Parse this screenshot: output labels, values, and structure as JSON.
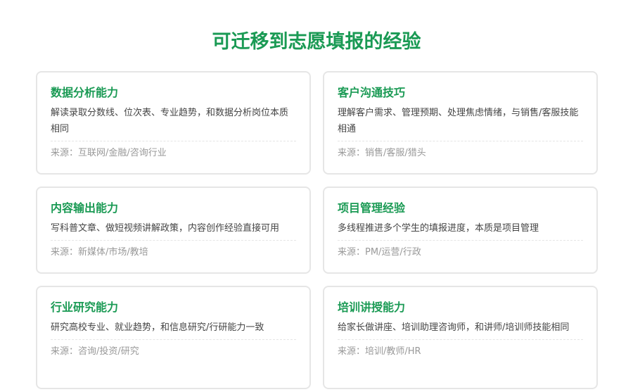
{
  "page": {
    "title": "可迁移到志愿填报的经验"
  },
  "cards": [
    {
      "title": "数据分析能力",
      "desc": "解读录取分数线、位次表、专业趋势，和数据分析岗位本质相同",
      "source": "来源：互联网/金融/咨询行业"
    },
    {
      "title": "客户沟通技巧",
      "desc": "理解客户需求、管理预期、处理焦虑情绪，与销售/客服技能相通",
      "source": "来源：销售/客服/猎头"
    },
    {
      "title": "内容输出能力",
      "desc": "写科普文章、做短视频讲解政策，内容创作经验直接可用",
      "source": "来源：新媒体/市场/教培"
    },
    {
      "title": "项目管理经验",
      "desc": "多线程推进多个学生的填报进度，本质是项目管理",
      "source": "来源：PM/运营/行政"
    },
    {
      "title": "行业研究能力",
      "desc": "研究高校专业、就业趋势，和信息研究/行研能力一致",
      "source": "来源：咨询/投资/研究"
    },
    {
      "title": "培训讲授能力",
      "desc": "给家长做讲座、培训助理咨询师，和讲师/培训师技能相同",
      "source": "来源：培训/教师/HR"
    }
  ]
}
